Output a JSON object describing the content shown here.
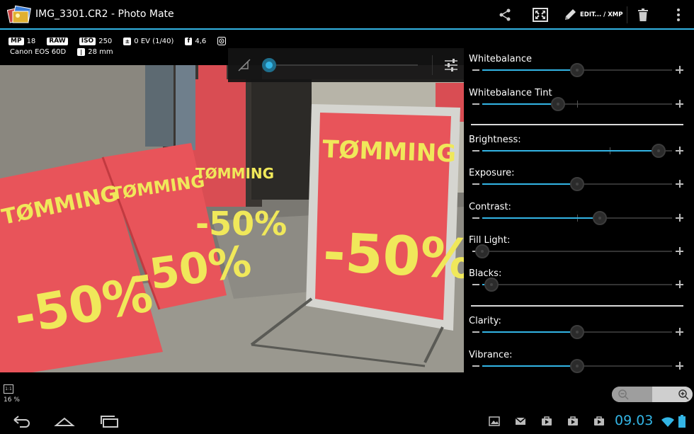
{
  "actionbar": {
    "title": "IMG_3301.CR2 - Photo Mate",
    "edit_label": "EDIT... / XMP"
  },
  "exif": {
    "mp_tag": "MP",
    "mp_value": "18",
    "raw_tag": "RAW",
    "iso_tag": "ISO",
    "iso_value": "250",
    "ev_value": "0 EV (1/40)",
    "aperture_tag": "f",
    "aperture_value": "4,6",
    "camera": "Canon EOS 60D",
    "focal_length": "28 mm"
  },
  "photo": {
    "sign_text": "TØMMING",
    "sign_value": "-50%"
  },
  "overlay": {
    "slider_value": 0.0
  },
  "sliders": [
    {
      "label": "Whitebalance",
      "value": 0.5,
      "center": 0.5
    },
    {
      "label": "Whitebalance Tint",
      "value": 0.4,
      "center": 0.5
    },
    {
      "label": "Brightness:",
      "value": 0.93,
      "center": 0.67
    },
    {
      "label": "Exposure:",
      "value": 0.5,
      "center": 0.5
    },
    {
      "label": "Contrast:",
      "value": 0.62,
      "center": 0.5
    },
    {
      "label": "Fill Light:",
      "value": 0.0,
      "center": 0.0
    },
    {
      "label": "Blacks:",
      "value": 0.05,
      "center": 0.0
    },
    {
      "label": "Clarity:",
      "value": 0.5,
      "center": 0.5
    },
    {
      "label": "Vibrance:",
      "value": 0.5,
      "center": 0.5
    }
  ],
  "zoom": {
    "ratio_label": "1:1",
    "percent": "16 %"
  },
  "statusbar": {
    "time": "09.03"
  },
  "colors": {
    "accent": "#33b5e5",
    "sign_red": "#e8545a",
    "sign_yellow": "#f0e85a"
  }
}
